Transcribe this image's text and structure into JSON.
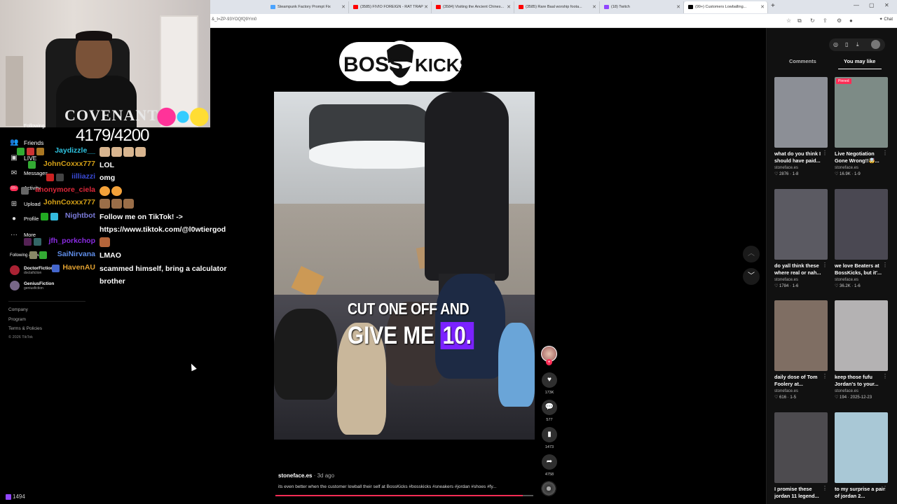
{
  "browser": {
    "tabs": [
      {
        "label": "Steampunk Factory Prompt Fix",
        "color": "#4aa3ff"
      },
      {
        "label": "(3585) FIVIO FOREIGN - RAT TRAP",
        "color": "#ff0000"
      },
      {
        "label": "(3584) Visiting the Ancient Chines...",
        "color": "#ff0000"
      },
      {
        "label": "(3585) Rare Baal worship foota...",
        "color": "#ff0000"
      },
      {
        "label": "(18) Twitch",
        "color": "#9146ff"
      },
      {
        "label": "(99+) Customers Lowballing...",
        "color": "#000000"
      }
    ],
    "new_tab": "+",
    "url": "&_t=ZP-93YOQfQ9Ym0",
    "chat_label": "Chat"
  },
  "stream": {
    "shirt_text": "COVENANT",
    "goal": "4179/4200",
    "bottom_count": "1494"
  },
  "left_nav": {
    "following": "Following",
    "friends": "Friends",
    "live": "LIVE",
    "messages": "Messages",
    "messages_badge": "99+",
    "activity": "Activity",
    "upload": "Upload",
    "profile": "Profile",
    "more": "More",
    "following_accounts": "Following accounts",
    "accounts": [
      {
        "name": "DoctorFiction",
        "handle": "doctafiction"
      },
      {
        "name": "GeniusFiction",
        "handle": "geniusfiction"
      }
    ],
    "footer": [
      "Company",
      "Program",
      "Terms & Policies"
    ],
    "copyright": "© 2026 TikTok"
  },
  "chat": [
    {
      "user": "Jaydizzle__",
      "color": "#2ec3e0",
      "text": ""
    },
    {
      "user": "JohnCoxxx777",
      "color": "#d4a017",
      "text": "LOL"
    },
    {
      "user": "iilliazzi",
      "color": "#3b4bd8",
      "text": "omg"
    },
    {
      "user": "anonymore_ciela",
      "color": "#e0283a",
      "text": ""
    },
    {
      "user": "JohnCoxxx777",
      "color": "#d4a017",
      "text": ""
    },
    {
      "user": "Nightbot",
      "color": "#7b7bd9",
      "text": "Follow me on TikTok! -> https://www.tiktok.com/@l0wtiergod"
    },
    {
      "user": "jfh_porkchop",
      "color": "#8a2be2",
      "text": ""
    },
    {
      "user": "SaiNirvana",
      "color": "#5f8de8",
      "text": "LMAO"
    },
    {
      "user": "HavenAU",
      "color": "#e0a030",
      "text": "scammed himself, bring a calculator brother"
    }
  ],
  "video": {
    "logo_left": "BOSS",
    "logo_right": "KICKS",
    "caption_line1": "CUT ONE OFF AND",
    "caption_line2_prefix": "GIVE ME ",
    "caption_line2_highlight": "10.",
    "author": "stoneface.es",
    "date": " · 3d ago",
    "description": "its even better when the customer lowball their self at BossKicks #bosskicks #sneakers #jordan #shoes #fy...",
    "progress": 0.96,
    "likes": "173K",
    "comments": "577",
    "saves": "1473",
    "shares": "4758"
  },
  "right_panel": {
    "tab_comments": "Comments",
    "tab_you_may_like": "You may like",
    "cards": [
      {
        "title": "what do you think I should have paid...",
        "author": "stoneface.es",
        "meta": "♡ 2876 · 1-8",
        "pinned": "",
        "bg": "#8c8f96"
      },
      {
        "title": "Live Negotiation Gone Wrong!!🤯...",
        "author": "stoneface.es",
        "meta": "♡ 16.9K · 1-9",
        "pinned": "Pinned",
        "bg": "#7d8b86"
      },
      {
        "title": "do yall think these where real or nah...",
        "author": "stoneface.es",
        "meta": "♡ 1784 · 1-6",
        "pinned": "",
        "bg": "#5b5a62"
      },
      {
        "title": "we love Beaters at BossKicks, but it'...",
        "author": "stoneface.es",
        "meta": "♡ 36.2K · 1-6",
        "pinned": "",
        "bg": "#4a4852"
      },
      {
        "title": "daily dose of Tom Foolery at...",
        "author": "stoneface.es",
        "meta": "♡ 616 · 1-5",
        "pinned": "",
        "bg": "#7f6e63"
      },
      {
        "title": "keep those fufu Jordan's to your...",
        "author": "stoneface.es",
        "meta": "♡ 194 · 2025-12-23",
        "pinned": "",
        "bg": "#b4b2b3"
      },
      {
        "title": "I promise these jordan 11 legend...",
        "author": "",
        "meta": "",
        "pinned": "",
        "bg": "#4d4b4f"
      },
      {
        "title": "to my surprise a pair of jordan 2...",
        "author": "",
        "meta": "",
        "pinned": "",
        "bg": "#a9c8d6"
      }
    ]
  }
}
